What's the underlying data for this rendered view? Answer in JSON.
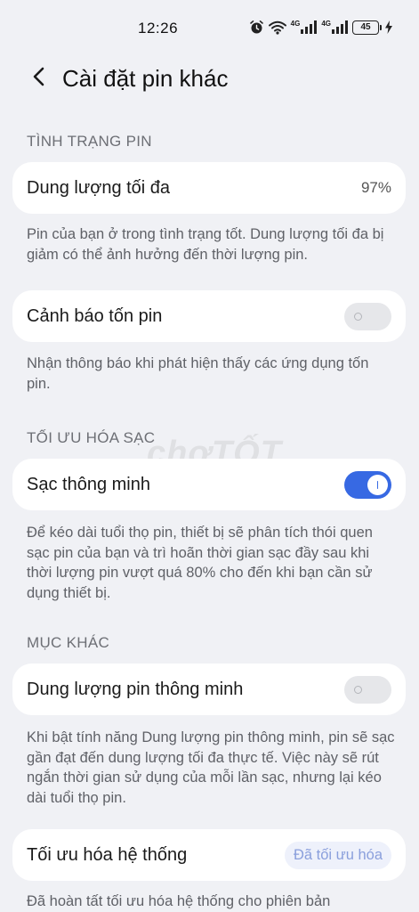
{
  "status_bar": {
    "time": "12:26",
    "network_1": "4G",
    "network_2": "4G",
    "battery_level": "45",
    "icons": [
      "alarm-icon",
      "wifi-icon",
      "signal-icon",
      "signal-icon",
      "battery-icon",
      "charging-icon"
    ]
  },
  "header": {
    "title": "Cài đặt pin khác",
    "back_icon": "chevron-left-icon"
  },
  "battery_status": {
    "section_label": "TÌNH TRẠNG PIN",
    "max_capacity_label": "Dung lượng tối đa",
    "max_capacity_value": "97%",
    "max_capacity_desc": "Pin của bạn ở trong tình trạng tốt. Dung lượng tối đa bị giảm có thể ảnh hưởng đến thời lượng pin.",
    "drain_alert_label": "Cảnh báo tốn pin",
    "drain_alert_enabled": false,
    "drain_alert_desc": "Nhận thông báo khi phát hiện thấy các ứng dụng tốn pin."
  },
  "charging_optimization": {
    "section_label": "TỐI ƯU HÓA SẠC",
    "smart_charging_label": "Sạc thông minh",
    "smart_charging_enabled": true,
    "smart_charging_desc": "Để kéo dài tuổi thọ pin, thiết bị sẽ phân tích thói quen sạc pin của bạn và trì hoãn thời gian sạc đầy sau khi thời lượng pin vượt quá 80% cho đến khi bạn cần sử dụng thiết bị."
  },
  "other": {
    "section_label": "MỤC KHÁC",
    "smart_capacity_label": "Dung lượng pin thông minh",
    "smart_capacity_enabled": false,
    "smart_capacity_desc": "Khi bật tính năng Dung lượng pin thông minh, pin sẽ sạc gần đạt đến dung lượng tối đa thực tế. Việc này sẽ rút ngắn thời gian sử dụng của mỗi lần sạc, nhưng lại kéo dài tuổi thọ pin.",
    "system_opt_label": "Tối ưu hóa hệ thống",
    "system_opt_button": "Đã tối ưu hóa",
    "system_opt_desc": "Đã hoàn tất tối ưu hóa hệ thống cho phiên bản"
  },
  "watermark": "chợTỐT",
  "colors": {
    "background": "#f0f1f5",
    "card": "#ffffff",
    "accent": "#3769e3",
    "muted_text": "#5f6167"
  }
}
